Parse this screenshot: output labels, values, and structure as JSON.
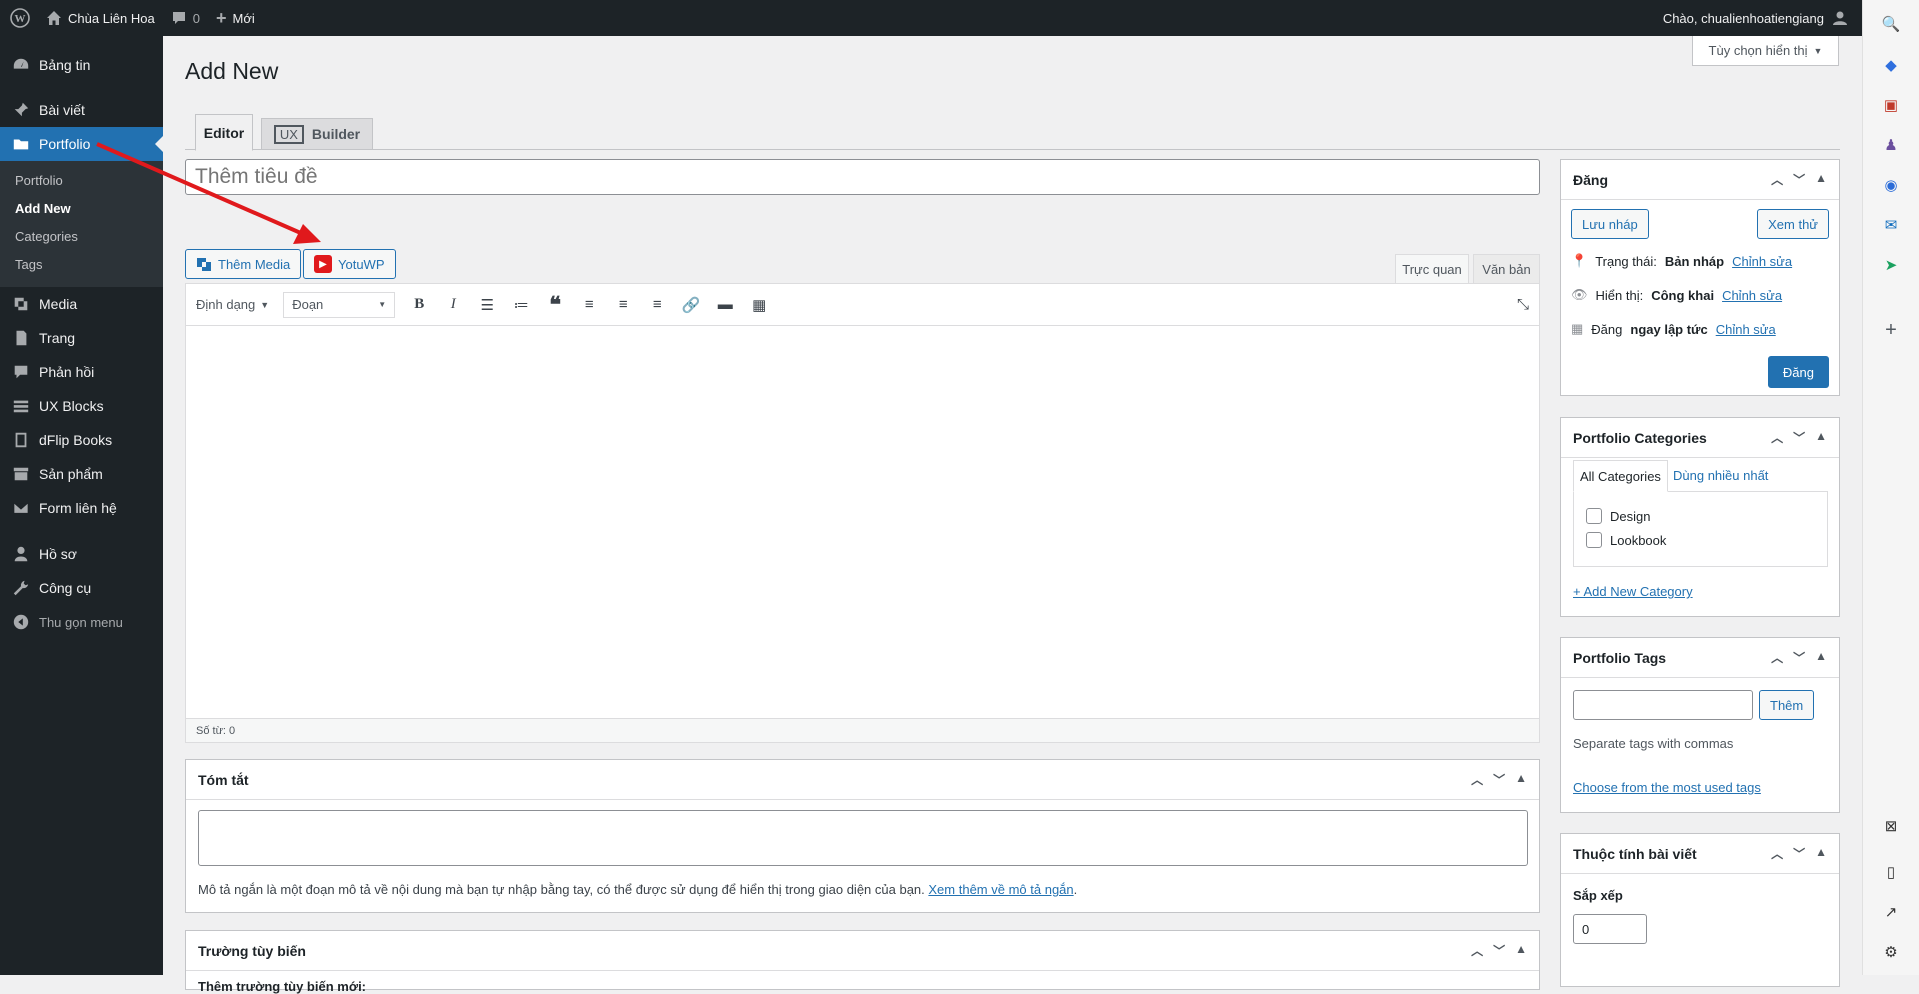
{
  "adminbar": {
    "site": "Chùa Liên Hoa",
    "comments": "0",
    "new": "Mới",
    "greeting": "Chào, chualienhoatiengiang"
  },
  "sidebar": {
    "items": [
      {
        "label": "Bảng tin",
        "icon": "dashboard-icon"
      },
      {
        "label": "Bài viết",
        "icon": "pin-icon"
      },
      {
        "label": "Portfolio",
        "icon": "portfolio-icon"
      },
      {
        "label": "Media",
        "icon": "media-icon"
      },
      {
        "label": "Trang",
        "icon": "page-icon"
      },
      {
        "label": "Phản hồi",
        "icon": "comment-icon"
      },
      {
        "label": "UX Blocks",
        "icon": "grid-icon"
      },
      {
        "label": "dFlip Books",
        "icon": "book-icon"
      },
      {
        "label": "Sản phẩm",
        "icon": "archive-icon"
      },
      {
        "label": "Form liên hệ",
        "icon": "mail-icon"
      },
      {
        "label": "Hồ sơ",
        "icon": "user-icon"
      },
      {
        "label": "Công cụ",
        "icon": "wrench-icon"
      },
      {
        "label": "Thu gọn menu",
        "icon": "collapse-icon"
      }
    ],
    "submenu": [
      "Portfolio",
      "Add New",
      "Categories",
      "Tags"
    ]
  },
  "screen_options": "Tùy chọn hiển thị",
  "page_title": "Add New",
  "tabs": {
    "editor": "Editor",
    "ux": "UX",
    "builder": "Builder"
  },
  "title_placeholder": "Thêm tiêu đề",
  "media_buttons": {
    "add_media": "Thêm Media",
    "yotuwp": "YotuWP"
  },
  "editor_tabs": {
    "visual": "Trực quan",
    "text": "Văn bản"
  },
  "toolbar": {
    "format": "Định dạng",
    "paragraph": "Đoạn"
  },
  "word_count": "Số từ: 0",
  "excerpt": {
    "title": "Tóm tắt",
    "help": "Mô tả ngắn là một đoạn mô tả về nội dung mà bạn tự nhập bằng tay, có thể được sử dụng để hiển thị trong giao diện của bạn.",
    "link": "Xem thêm về mô tả ngắn"
  },
  "custom_fields": {
    "title": "Trường tùy biến",
    "add_label": "Thêm trường tùy biến mới:"
  },
  "publish": {
    "title": "Đăng",
    "save_draft": "Lưu nháp",
    "preview": "Xem thử",
    "status_label": "Trạng thái:",
    "status_value": "Bản nháp",
    "visibility_label": "Hiển thị:",
    "visibility_value": "Công khai",
    "publish_label": "Đăng",
    "publish_value": "ngay lập tức",
    "edit": "Chỉnh sửa",
    "publish_button": "Đăng"
  },
  "categories": {
    "title": "Portfolio Categories",
    "tab_all": "All Categories",
    "tab_popular": "Dùng nhiều nhất",
    "items": [
      "Design",
      "Lookbook"
    ],
    "add_new": "+ Add New Category"
  },
  "tags": {
    "title": "Portfolio Tags",
    "add_button": "Thêm",
    "help": "Separate tags with commas",
    "choose": "Choose from the most used tags"
  },
  "attributes": {
    "title": "Thuộc tính bài viết",
    "order_label": "Sắp xếp",
    "order_value": "0"
  },
  "colors": {
    "admin_dark": "#1d2327",
    "accent": "#2271b1",
    "annotation": "#e0191c"
  }
}
